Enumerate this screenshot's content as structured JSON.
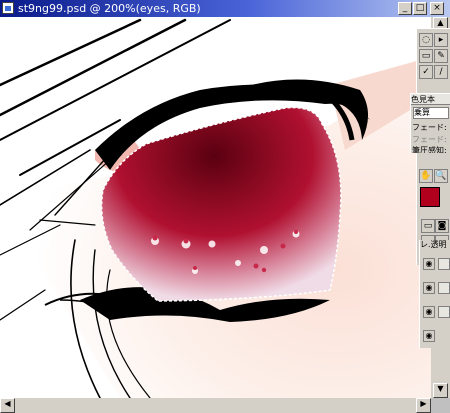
{
  "window": {
    "title": "st9ng99.psd @ 200%(eyes, RGB)",
    "minimize_glyph": "_",
    "maximize_glyph": "□",
    "close_glyph": "×"
  },
  "tools": {
    "items": [
      {
        "name": "lasso-tool-icon",
        "glyph": "◌"
      },
      {
        "name": "move-tool-icon",
        "glyph": "▸"
      },
      {
        "name": "marquee-tool-icon",
        "glyph": "▭"
      },
      {
        "name": "pencil-tool-icon",
        "glyph": "✎"
      },
      {
        "name": "check-icon",
        "glyph": "✓"
      },
      {
        "name": "brush-tool-icon",
        "glyph": "/"
      },
      {
        "name": "hand-tool-icon",
        "glyph": "✋"
      },
      {
        "name": "zoom-tool-icon",
        "glyph": "🔍"
      }
    ]
  },
  "panel": {
    "tab_label": "色見本",
    "layer_name": "乗算",
    "fade_label": "フェード:",
    "fade_label_2": "フェード:",
    "pressure_label": "筆圧感知:"
  },
  "colors": {
    "foreground": "#b0001e",
    "background": "#ffffff",
    "title_start": "#0a1a8a",
    "title_end": "#b8c8f0",
    "iris_dark": "#5a0010",
    "iris_mid": "#b01030",
    "iris_light": "#f0dce6"
  },
  "layers": {
    "header": "レ.透明",
    "eye_icon": "eye-icon"
  }
}
